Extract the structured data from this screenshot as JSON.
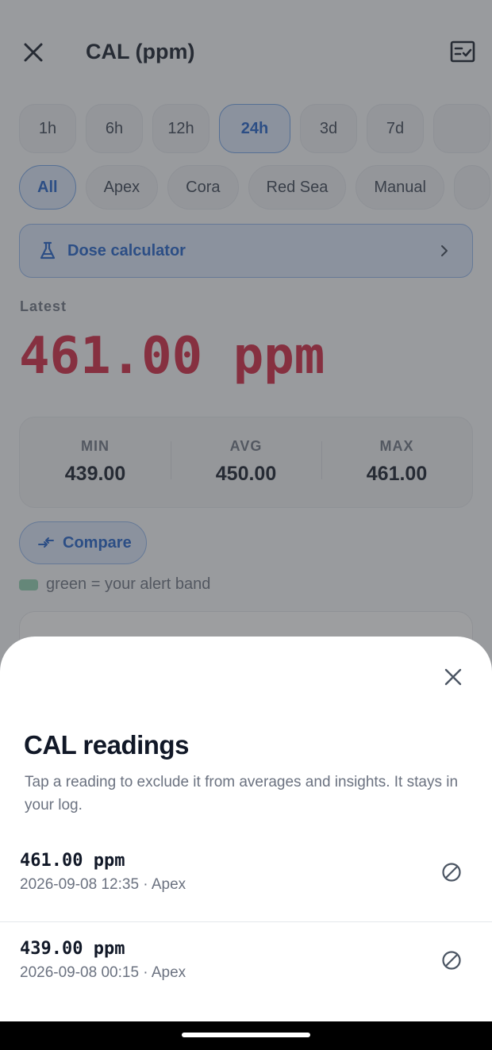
{
  "header": {
    "title": "CAL (ppm)",
    "close_icon": "close-icon",
    "checklist_icon": "checklist-icon"
  },
  "time_ranges": [
    {
      "label": "1h",
      "active": false
    },
    {
      "label": "6h",
      "active": false
    },
    {
      "label": "12h",
      "active": false
    },
    {
      "label": "24h",
      "active": true
    },
    {
      "label": "3d",
      "active": false
    },
    {
      "label": "7d",
      "active": false
    }
  ],
  "sources": [
    {
      "label": "All",
      "active": true
    },
    {
      "label": "Apex",
      "active": false
    },
    {
      "label": "Cora",
      "active": false
    },
    {
      "label": "Red Sea",
      "active": false
    },
    {
      "label": "Manual",
      "active": false
    }
  ],
  "dose_calculator": {
    "label": "Dose calculator",
    "icon": "flask-icon"
  },
  "latest": {
    "label": "Latest",
    "value": "461.00 ppm"
  },
  "stats": {
    "min_label": "MIN",
    "min_value": "439.00",
    "avg_label": "AVG",
    "avg_value": "450.00",
    "max_label": "MAX",
    "max_value": "461.00"
  },
  "compare": {
    "label": "Compare"
  },
  "legend": {
    "text": "green = your alert band",
    "color": "#8fd0b0"
  },
  "sheet": {
    "title": "CAL readings",
    "description": "Tap a reading to exclude it from averages and insights. It stays in your log.",
    "readings": [
      {
        "value": "461.00 ppm",
        "meta": "2026-09-08 12:35 · Apex"
      },
      {
        "value": "439.00 ppm",
        "meta": "2026-09-08 00:15 · Apex"
      }
    ]
  },
  "colors": {
    "accent": "#1d5fc9",
    "latest_value": "#d0233f"
  }
}
